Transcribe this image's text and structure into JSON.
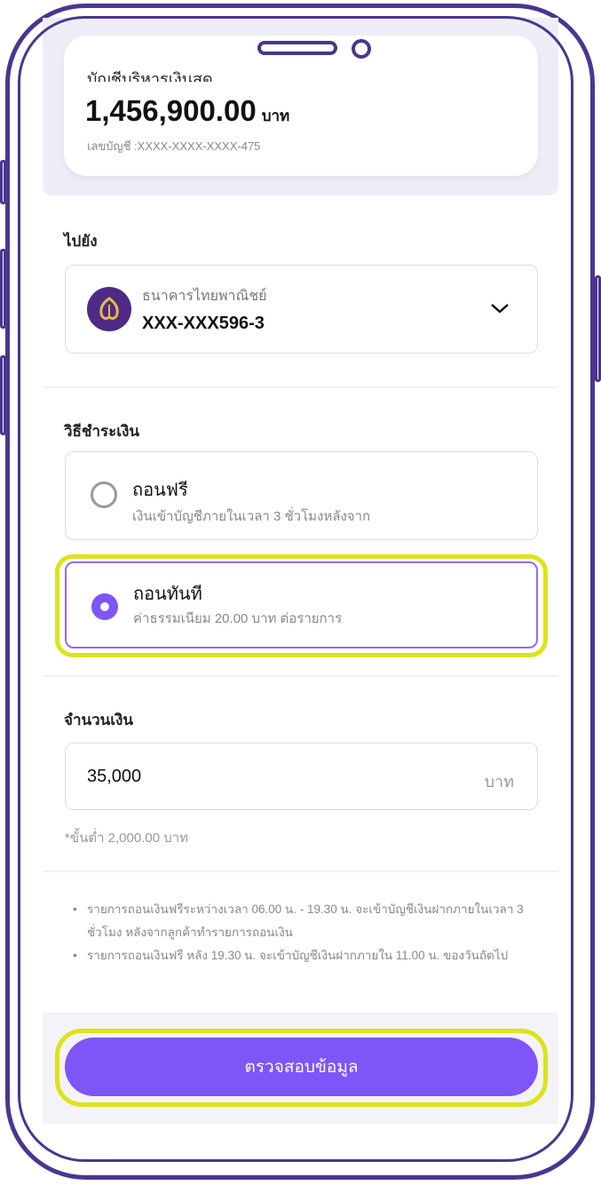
{
  "account": {
    "name": "บัญชีบริหารเงินสด",
    "amount": "1,456,900.00",
    "unit": "บาท",
    "number": "เลขบัญชี :XXXX-XXXX-XXXX-475"
  },
  "destination": {
    "label": "ไปยัง",
    "bank_name": "ธนาคารไทยพาณิชย์",
    "account_no": "XXX-XXX596-3",
    "icon": "chevron-down-icon"
  },
  "payment_method": {
    "label": "วิธีชำระเงิน",
    "options": [
      {
        "title": "ถอนฟรี",
        "subtitle": "เงินเข้าบัญชีภายในเวลา 3 ชั่วโมงหลังจาก",
        "selected": false
      },
      {
        "title": "ถอนทันที",
        "subtitle": "ค่าธรรมเนียม 20.00 บาท ต่อรายการ",
        "selected": true
      }
    ]
  },
  "amount": {
    "label": "จำนวนเงิน",
    "value": "35,000",
    "unit": "บาท",
    "hint": "*ขั้นต่ำ 2,000.00 บาท"
  },
  "notes": [
    "รายการถอนเงินฟรีระหว่างเวลา 06.00 น. - 19.30 น. จะเข้าบัญชีเงินฝากภายในเวลา 3 ชั่วโมง หลังจากลูกค้าทำรายการถอนเงิน",
    "รายการถอนเงินฟรี หลัง 19.30 น. จะเข้าบัญชีเงินฝากภายใน 11.00 น. ของวันถัดไป"
  ],
  "submit_label": "ตรวจสอบข้อมูล",
  "colors": {
    "accent": "#7e55f7",
    "frame": "#4b3591",
    "highlight": "#dde31a",
    "bank": "#4e2a84"
  }
}
